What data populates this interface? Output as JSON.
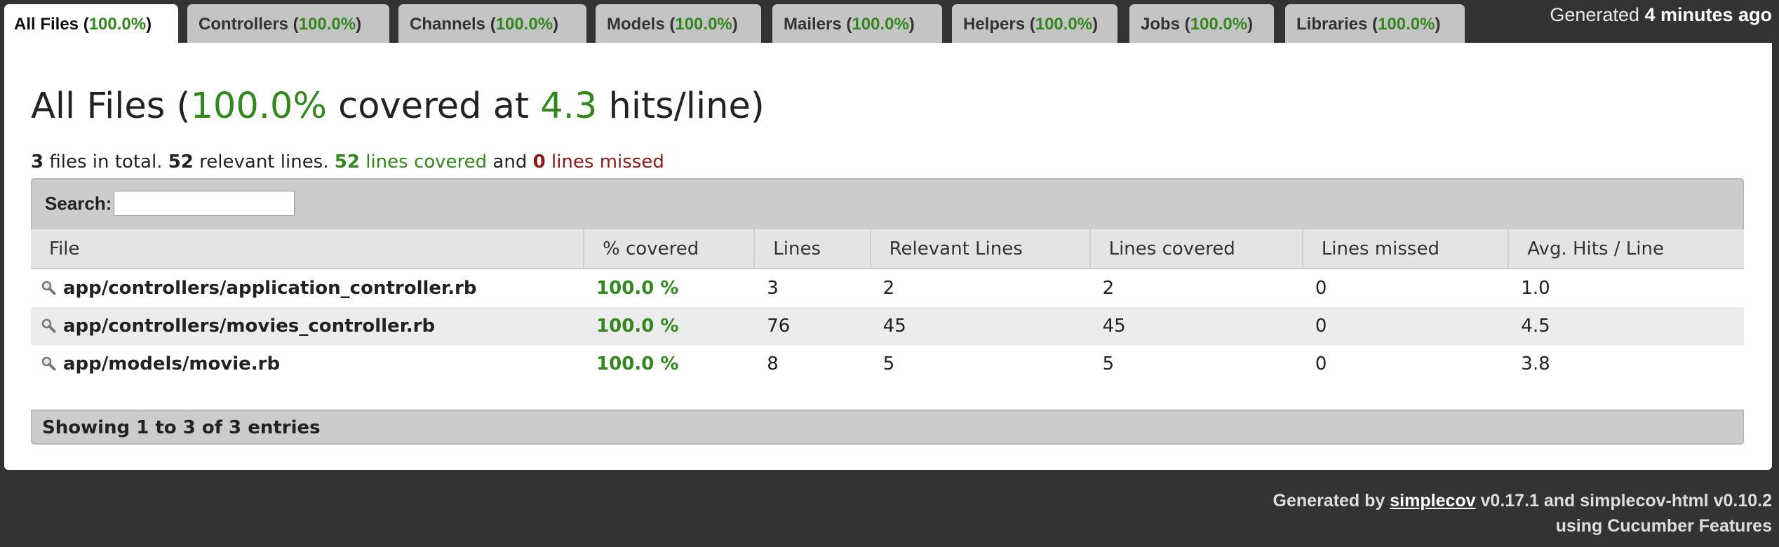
{
  "tabs": [
    {
      "label": "All Files",
      "pct": "100.0%",
      "active": true
    },
    {
      "label": "Controllers",
      "pct": "100.0%"
    },
    {
      "label": "Channels",
      "pct": "100.0%"
    },
    {
      "label": "Models",
      "pct": "100.0%"
    },
    {
      "label": "Mailers",
      "pct": "100.0%"
    },
    {
      "label": "Helpers",
      "pct": "100.0%"
    },
    {
      "label": "Jobs",
      "pct": "100.0%"
    },
    {
      "label": "Libraries",
      "pct": "100.0%"
    }
  ],
  "generated": {
    "prefix": "Generated ",
    "time": "4 minutes ago"
  },
  "headline": {
    "prefix": "All Files (",
    "pct": "100.0%",
    "mid": " covered at ",
    "hits": "4.3",
    "suffix": " hits/line)"
  },
  "summary": {
    "files": "3",
    "files_text": " files in total. ",
    "relevant": "52",
    "relevant_text": " relevant lines. ",
    "covered": "52",
    "covered_text": " lines covered",
    "and_text": " and ",
    "missed": "0",
    "missed_text": " lines missed"
  },
  "search": {
    "label": "Search:",
    "value": "",
    "placeholder": ""
  },
  "columns": [
    "File",
    "% covered",
    "Lines",
    "Relevant Lines",
    "Lines covered",
    "Lines missed",
    "Avg. Hits / Line"
  ],
  "rows": [
    {
      "file": "app/controllers/application_controller.rb",
      "covered": "100.0 %",
      "lines": "3",
      "relevant": "2",
      "lines_covered": "2",
      "missed": "0",
      "avg": "1.0"
    },
    {
      "file": "app/controllers/movies_controller.rb",
      "covered": "100.0 %",
      "lines": "76",
      "relevant": "45",
      "lines_covered": "45",
      "missed": "0",
      "avg": "4.5"
    },
    {
      "file": "app/models/movie.rb",
      "covered": "100.0 %",
      "lines": "8",
      "relevant": "5",
      "lines_covered": "5",
      "missed": "0",
      "avg": "3.8"
    }
  ],
  "showing": "Showing 1 to 3 of 3 entries",
  "footer": {
    "line1_prefix": "Generated by ",
    "link": "simplecov",
    "line1_suffix": " v0.17.1 and simplecov-html v0.10.2",
    "line2": "using Cucumber Features"
  },
  "colors": {
    "covered": "#34871e",
    "missed": "#8b1a1a",
    "background": "#333333"
  },
  "icons": {
    "row": "magnifier-icon"
  }
}
